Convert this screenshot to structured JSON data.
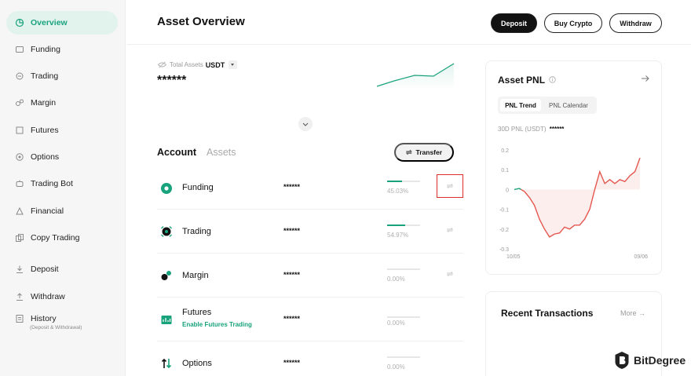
{
  "sidebar": {
    "items": [
      {
        "label": "Overview",
        "icon": "overview-icon",
        "active": true
      },
      {
        "label": "Funding",
        "icon": "funding-icon"
      },
      {
        "label": "Trading",
        "icon": "trading-icon"
      },
      {
        "label": "Margin",
        "icon": "margin-icon"
      },
      {
        "label": "Futures",
        "icon": "futures-icon"
      },
      {
        "label": "Options",
        "icon": "options-icon"
      },
      {
        "label": "Trading Bot",
        "icon": "trading-bot-icon"
      },
      {
        "label": "Financial",
        "icon": "financial-icon"
      },
      {
        "label": "Copy Trading",
        "icon": "copy-trading-icon"
      },
      {
        "label": "Deposit",
        "icon": "deposit-icon"
      },
      {
        "label": "Withdraw",
        "icon": "withdraw-icon"
      },
      {
        "label": "History",
        "icon": "history-icon"
      }
    ],
    "history_sub": "(Deposit & Withdrawal)"
  },
  "header": {
    "title": "Asset Overview",
    "deposit": "Deposit",
    "buy_crypto": "Buy Crypto",
    "withdraw": "Withdraw"
  },
  "total": {
    "label": "Total Assets",
    "currency": "USDT",
    "value": "******"
  },
  "tabs": {
    "account": "Account",
    "assets": "Assets",
    "transfer": "Transfer",
    "transfer_icon": "⇌"
  },
  "accounts": [
    {
      "name": "Funding",
      "value": "******",
      "pct": "45.03%",
      "pct_value": 45.03,
      "icon": "funding-account-icon"
    },
    {
      "name": "Trading",
      "value": "******",
      "pct": "54.97%",
      "pct_value": 54.97,
      "icon": "trading-account-icon"
    },
    {
      "name": "Margin",
      "value": "******",
      "pct": "0.00%",
      "pct_value": 0,
      "icon": "margin-account-icon"
    },
    {
      "name": "Futures",
      "sub": "Enable Futures Trading",
      "value": "******",
      "pct": "0.00%",
      "pct_value": 0,
      "icon": "futures-account-icon"
    },
    {
      "name": "Options",
      "value": "******",
      "pct": "0.00%",
      "pct_value": 0,
      "icon": "options-account-icon"
    }
  ],
  "pnl": {
    "title": "Asset PNL",
    "tab_trend": "PNL Trend",
    "tab_calendar": "PNL Calendar",
    "sub_label": "30D PNL (USDT)",
    "sub_value": "******"
  },
  "recent": {
    "title": "Recent Transactions",
    "more": "More →"
  },
  "watermark": "BitDegree",
  "colors": {
    "accent": "#19a37c",
    "loss": "#e5574f",
    "highlight": "#e02b2b"
  },
  "chart_data": {
    "type": "line",
    "title": "",
    "xlabel": "",
    "ylabel": "",
    "x_tick_labels": [
      "10/05",
      "09/06"
    ],
    "y_tick_labels": [
      "0.2",
      "0.1",
      "0",
      "-0.1",
      "-0.2",
      "-0.3"
    ],
    "ylim": [
      -0.3,
      0.2
    ],
    "grid": false,
    "series": [
      {
        "values": [
          0,
          0.005,
          -0.01,
          -0.04,
          -0.08,
          -0.15,
          -0.2,
          -0.24,
          -0.225,
          -0.22,
          -0.19,
          -0.2,
          -0.18,
          -0.18,
          -0.15,
          -0.1,
          0.0,
          0.09,
          0.03,
          0.05,
          0.03,
          0.05,
          0.04,
          0.07,
          0.09,
          0.16
        ]
      }
    ]
  }
}
